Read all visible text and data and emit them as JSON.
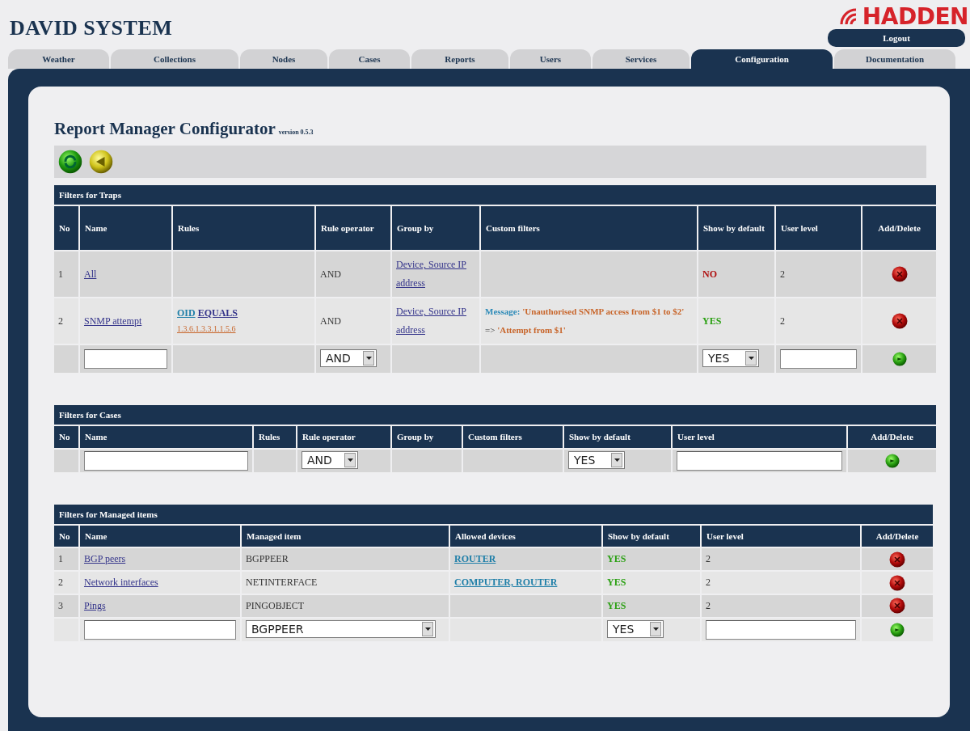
{
  "app": {
    "title": "DAVID SYSTEM",
    "logo": "HADDEN",
    "logout": "Logout"
  },
  "tabs": [
    {
      "label": "Weather",
      "selected": false
    },
    {
      "label": "Collections",
      "selected": false
    },
    {
      "label": "Nodes",
      "selected": false
    },
    {
      "label": "Cases",
      "selected": false
    },
    {
      "label": "Reports",
      "selected": false
    },
    {
      "label": "Users",
      "selected": false
    },
    {
      "label": "Services",
      "selected": false
    },
    {
      "label": "Configuration",
      "selected": true
    },
    {
      "label": "Documentation",
      "selected": false
    }
  ],
  "page": {
    "title": "Report Manager Configurator",
    "version": "version 0.5.3"
  },
  "sections": [
    {
      "title": "Filters for Traps",
      "columns": [
        "No",
        "Name",
        "Rules",
        "Rule operator",
        "Group by",
        "Custom filters",
        "Show by default",
        "User level",
        "Add/Delete"
      ],
      "rows": [
        {
          "cells": [
            {
              "kind": "text",
              "text": "1"
            },
            {
              "kind": "link",
              "text": "All"
            },
            {
              "kind": "empty"
            },
            {
              "kind": "text",
              "text": "AND"
            },
            {
              "kind": "link",
              "text": "Device, Source IP address"
            },
            {
              "kind": "empty"
            },
            {
              "kind": "flag",
              "text": "NO",
              "on": false
            },
            {
              "kind": "text",
              "text": "2"
            },
            {
              "kind": "delete"
            }
          ]
        },
        {
          "cells": [
            {
              "kind": "text",
              "text": "2"
            },
            {
              "kind": "link",
              "text": "SNMP attempt"
            },
            {
              "kind": "rule",
              "parts": [
                {
                  "kind": "field",
                  "text": "OID"
                },
                {
                  "kind": "op",
                  "text": "EQUALS"
                },
                {
                  "kind": "value",
                  "text": "1.3.6.1.3.3.1.1.5.6"
                }
              ]
            },
            {
              "kind": "text",
              "text": "AND"
            },
            {
              "kind": "link",
              "text": "Device, Source IP address"
            },
            {
              "kind": "filter",
              "parts": [
                {
                  "kind": "field",
                  "text": "Message:"
                },
                {
                  "kind": "value",
                  "text": "'Unauthorised SNMP access from $1 to $2'"
                },
                {
                  "kind": "op",
                  "text": "=>"
                },
                {
                  "kind": "value",
                  "text": "'Attempt from $1'"
                }
              ]
            },
            {
              "kind": "flag",
              "text": "YES",
              "on": true
            },
            {
              "kind": "text",
              "text": "2"
            },
            {
              "kind": "delete"
            }
          ]
        },
        {
          "cells": [
            {
              "kind": "empty"
            },
            {
              "kind": "input"
            },
            {
              "kind": "empty"
            },
            {
              "kind": "select",
              "value": "AND"
            },
            {
              "kind": "empty"
            },
            {
              "kind": "empty"
            },
            {
              "kind": "select",
              "value": "YES"
            },
            {
              "kind": "input"
            },
            {
              "kind": "add"
            }
          ]
        }
      ]
    },
    {
      "title": "Filters for Cases",
      "columns": [
        "No",
        "Name",
        "Rules",
        "Rule operator",
        "Group by",
        "Custom filters",
        "Show by default",
        "User level",
        "Add/Delete"
      ],
      "rows": [
        {
          "cells": [
            {
              "kind": "empty"
            },
            {
              "kind": "input"
            },
            {
              "kind": "empty"
            },
            {
              "kind": "select",
              "value": "AND"
            },
            {
              "kind": "empty"
            },
            {
              "kind": "empty"
            },
            {
              "kind": "select",
              "value": "YES"
            },
            {
              "kind": "input"
            },
            {
              "kind": "add"
            }
          ]
        }
      ]
    },
    {
      "title": "Filters for Managed items",
      "columns": [
        "No",
        "Name",
        "Managed item",
        "Allowed devices",
        "Show by default",
        "User level",
        "Add/Delete"
      ],
      "rows": [
        {
          "cells": [
            {
              "kind": "text",
              "text": "1"
            },
            {
              "kind": "link",
              "text": "BGP peers"
            },
            {
              "kind": "text",
              "text": "BGPPEER"
            },
            {
              "kind": "device",
              "text": "ROUTER"
            },
            {
              "kind": "flag",
              "text": "YES",
              "on": true
            },
            {
              "kind": "text",
              "text": "2"
            },
            {
              "kind": "delete"
            }
          ]
        },
        {
          "cells": [
            {
              "kind": "text",
              "text": "2"
            },
            {
              "kind": "link",
              "text": "Network interfaces"
            },
            {
              "kind": "text",
              "text": "NETINTERFACE"
            },
            {
              "kind": "device",
              "text": "COMPUTER, ROUTER"
            },
            {
              "kind": "flag",
              "text": "YES",
              "on": true
            },
            {
              "kind": "text",
              "text": "2"
            },
            {
              "kind": "delete"
            }
          ]
        },
        {
          "cells": [
            {
              "kind": "text",
              "text": "3"
            },
            {
              "kind": "link",
              "text": "Pings"
            },
            {
              "kind": "text",
              "text": "PINGOBJECT"
            },
            {
              "kind": "empty"
            },
            {
              "kind": "flag",
              "text": "YES",
              "on": true
            },
            {
              "kind": "text",
              "text": "2"
            },
            {
              "kind": "delete"
            }
          ]
        },
        {
          "cells": [
            {
              "kind": "empty"
            },
            {
              "kind": "input"
            },
            {
              "kind": "select",
              "value": "BGPPEER"
            },
            {
              "kind": "empty"
            },
            {
              "kind": "select",
              "value": "YES"
            },
            {
              "kind": "input"
            },
            {
              "kind": "add"
            }
          ]
        }
      ]
    }
  ]
}
